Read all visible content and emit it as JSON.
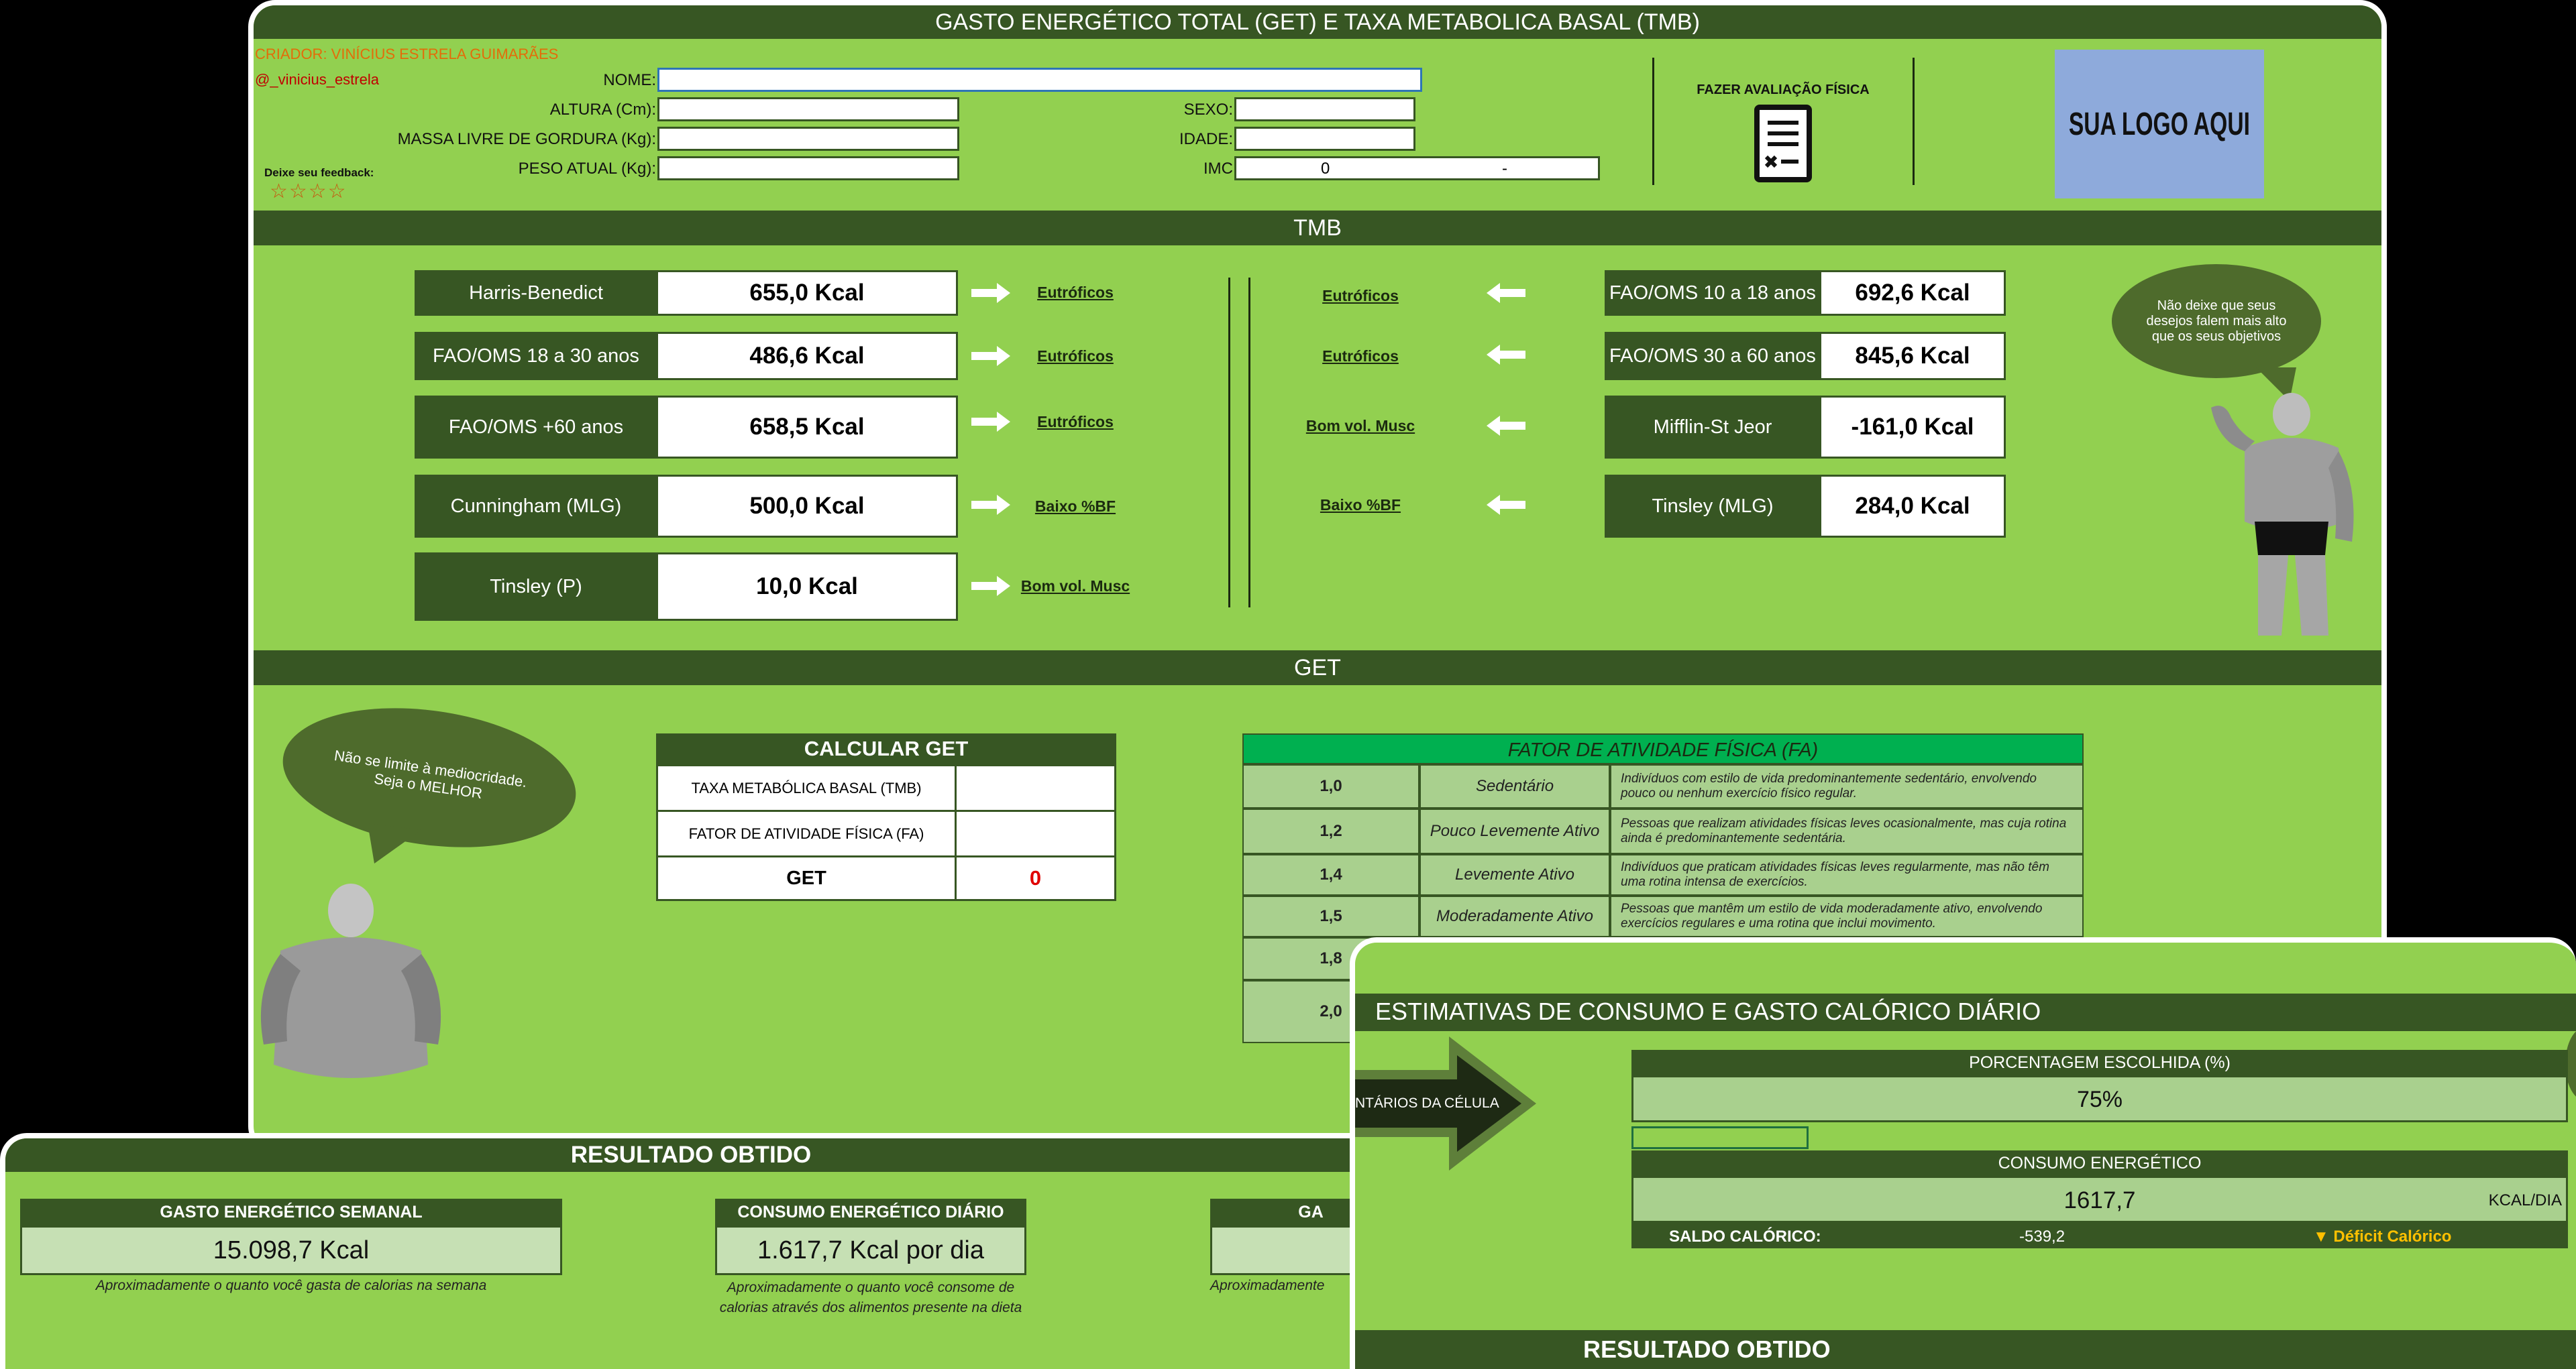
{
  "header": {
    "title": "GASTO ENERGÉTICO TOTAL (GET) E TAXA METABOLICA BASAL (TMB)"
  },
  "creator": {
    "name": "CRIADOR: VINÍCIUS ESTRELA GUIMARÃES",
    "handle": "@_vinicius_estrela"
  },
  "feedback": {
    "label": "Deixe seu feedback:",
    "stars": "☆☆☆☆"
  },
  "form": {
    "nome_label": "NOME:",
    "altura_label": "ALTURA (Cm):",
    "mlg_label": "MASSA LIVRE DE GORDURA (Kg):",
    "peso_label": "PESO ATUAL (Kg):",
    "sexo_label": "SEXO:",
    "idade_label": "IDADE:",
    "imc_label": "IMC",
    "imc_value": "0",
    "imc_class": "-"
  },
  "avaliacao": {
    "label": "FAZER AVALIAÇÃO FÍSICA"
  },
  "logo": {
    "text": "SUA LOGO AQUI"
  },
  "tmb": {
    "title": "TMB",
    "left": [
      {
        "label": "Harris-Benedict",
        "value": "655,0 Kcal",
        "result": "Eutróficos"
      },
      {
        "label": "FAO/OMS 18 a 30 anos",
        "value": "486,6 Kcal",
        "result": "Eutróficos"
      },
      {
        "label": "FAO/OMS +60 anos",
        "value": "658,5 Kcal",
        "result": "Eutróficos"
      },
      {
        "label": "Cunningham (MLG)",
        "value": "500,0 Kcal",
        "result": "Baixo %BF"
      },
      {
        "label": "Tinsley (P)",
        "value": "10,0 Kcal",
        "result": "Bom vol. Musc"
      }
    ],
    "right": [
      {
        "label": "FAO/OMS 10 a 18 anos",
        "value": "692,6 Kcal",
        "result": "Eutróficos"
      },
      {
        "label": "FAO/OMS 30 a 60 anos",
        "value": "845,6 Kcal",
        "result": "Eutróficos"
      },
      {
        "label": "Mifflin-St Jeor",
        "value": "-161,0 Kcal",
        "result": "Bom vol. Musc"
      },
      {
        "label": "Tinsley (MLG)",
        "value": "284,0 Kcal",
        "result": "Baixo %BF"
      }
    ],
    "quote": "Não deixe que seus desejos falem mais alto que os seus objetivos"
  },
  "get": {
    "title": "GET",
    "quote": "Não se limite à mediocridade. Seja o MELHOR",
    "calc": {
      "title": "CALCULAR GET",
      "tmb_label": "TAXA METABÓLICA BASAL (TMB)",
      "fa_label": "FATOR DE ATIVIDADE FÍSICA (FA)",
      "get_label": "GET",
      "get_value": "0"
    },
    "fa_table": {
      "title": "FATOR DE ATIVIDADE FÍSICA (FA)",
      "rows": [
        {
          "factor": "1,0",
          "level": "Sedentário",
          "desc": "Indivíduos com estilo de vida predominantemente sedentário, envolvendo pouco ou nenhum exercício físico regular."
        },
        {
          "factor": "1,2",
          "level": "Pouco Levemente Ativo",
          "desc": "Pessoas que realizam atividades físicas leves ocasionalmente, mas cuja rotina ainda é predominantemente sedentária."
        },
        {
          "factor": "1,4",
          "level": "Levemente Ativo",
          "desc": "Indivíduos que praticam atividades físicas leves regularmente, mas não têm uma rotina intensa de exercícios."
        },
        {
          "factor": "1,5",
          "level": "Moderadamente Ativo",
          "desc": "Pessoas que mantêm um estilo de vida moderadamente ativo, envolvendo exercícios regulares e uma rotina que inclui movimento."
        },
        {
          "factor": "1,8",
          "level": "",
          "desc": ""
        },
        {
          "factor": "2,0",
          "level": "",
          "desc": ""
        }
      ]
    }
  },
  "resultado": {
    "title": "RESULTADO OBTIDO",
    "cards": [
      {
        "head": "GASTO ENERGÉTICO SEMANAL",
        "value": "15.098,7 Kcal",
        "note": "Aproximadamente o quanto você gasta de calorias na semana"
      },
      {
        "head": "CONSUMO ENERGÉTICO DIÁRIO",
        "value": "1.617,7 Kcal por dia",
        "note": "Aproximadamente o quanto você consome de calorias através dos alimentos presente na dieta"
      },
      {
        "head": "GA",
        "value": "",
        "note": "Aproximadamente"
      }
    ]
  },
  "estimativas": {
    "title": "ESTIMATIVAS DE CONSUMO E GASTO CALÓRICO DIÁRIO",
    "arrow_text": "NTÁRIOS DA CÉLULA",
    "pct_label": "PORCENTAGEM ESCOLHIDA (%)",
    "pct_value": "75%",
    "consumo_label": "CONSUMO ENERGÉTICO",
    "consumo_value": "1617,7",
    "consumo_unit": "KCAL/DIA",
    "saldo_label": "SALDO CALÓRICO:",
    "saldo_value": "-539,2",
    "saldo_status": "▼ Déficit Calórico",
    "footer_title": "RESULTADO OBTIDO"
  },
  "colors": {
    "panel": "#92d050",
    "dark": "#375623",
    "table_head": "#00b050",
    "deficit": "#ffc000",
    "red_value": "#e00000"
  }
}
